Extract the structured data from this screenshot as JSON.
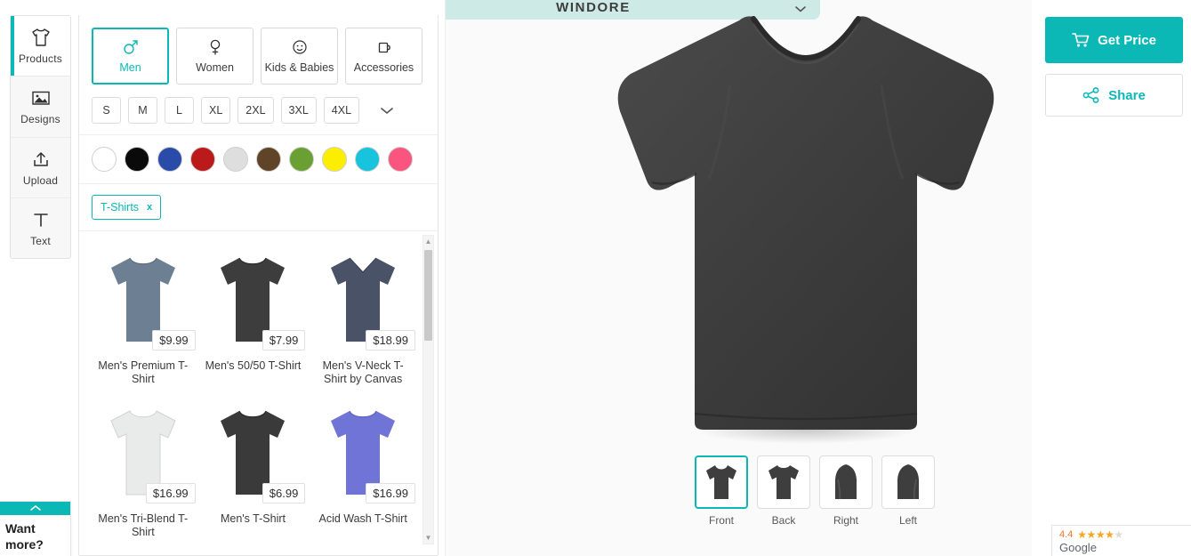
{
  "rail": {
    "items": [
      {
        "label": "Products",
        "icon": "tshirt-icon",
        "active": true
      },
      {
        "label": "Designs",
        "icon": "image-icon",
        "active": false
      },
      {
        "label": "Upload",
        "icon": "upload-icon",
        "active": false
      },
      {
        "label": "Text",
        "icon": "text-icon",
        "active": false
      }
    ]
  },
  "categories": [
    {
      "label": "Men",
      "icon": "male-icon",
      "active": true
    },
    {
      "label": "Women",
      "icon": "female-icon",
      "active": false
    },
    {
      "label": "Kids & Babies",
      "icon": "baby-face-icon",
      "active": false
    },
    {
      "label": "Accessories",
      "icon": "mug-icon",
      "active": false
    }
  ],
  "sizes": [
    "S",
    "M",
    "L",
    "XL",
    "2XL",
    "3XL",
    "4XL"
  ],
  "size_more_icon": "chevron-down-icon",
  "colors": [
    {
      "name": "white",
      "hex": "#ffffff"
    },
    {
      "name": "black",
      "hex": "#0a0a0a"
    },
    {
      "name": "royal-blue",
      "hex": "#2b4ba8"
    },
    {
      "name": "red",
      "hex": "#bb1a1a"
    },
    {
      "name": "ash-grey",
      "hex": "#dedede"
    },
    {
      "name": "brown",
      "hex": "#5f4428"
    },
    {
      "name": "green",
      "hex": "#6aa033"
    },
    {
      "name": "yellow",
      "hex": "#fcee00"
    },
    {
      "name": "cyan",
      "hex": "#17c3dd"
    },
    {
      "name": "pink",
      "hex": "#f9557f"
    }
  ],
  "filter_tag": {
    "label": "T-Shirts",
    "remove": "x"
  },
  "products": [
    {
      "name": "Men's Premium T-Shirt",
      "price": "$9.99",
      "color": "#6d7f93"
    },
    {
      "name": "Men's 50/50 T-Shirt",
      "price": "$7.99",
      "color": "#3d3d3d"
    },
    {
      "name": "Men's V-Neck T-Shirt by Canvas",
      "price": "$18.99",
      "color": "#4a5267",
      "neck": "v"
    },
    {
      "name": "Men's Tri-Blend T-Shirt",
      "price": "$16.99",
      "color": "#e9eaea"
    },
    {
      "name": "Men's T-Shirt",
      "price": "$6.99",
      "color": "#3a3a3a"
    },
    {
      "name": "Acid Wash T-Shirt",
      "price": "$16.99",
      "color": "#6f74d6"
    }
  ],
  "scrollbar": {
    "up_icon": "caret-up-icon",
    "down_icon": "caret-down-icon"
  },
  "stage": {
    "brand_name": "WINDORE",
    "brand_chevron_icon": "chevron-down-icon",
    "shirt_color": "#3e3e3e",
    "views": [
      {
        "label": "Front",
        "active": true
      },
      {
        "label": "Back",
        "active": false
      },
      {
        "label": "Right",
        "active": false
      },
      {
        "label": "Left",
        "active": false
      }
    ]
  },
  "actions": {
    "get_price": {
      "label": "Get Price",
      "icon": "cart-icon",
      "color": "#0cb8b6"
    },
    "share": {
      "label": "Share",
      "icon": "share-icon",
      "color": "#0cb8b6"
    }
  },
  "want_more": {
    "line1": "Want",
    "line2": "more?",
    "toggle_icon": "chevron-up-icon"
  },
  "google_badge": {
    "rating": "4.4",
    "stars": 4.5,
    "label": "Google"
  }
}
